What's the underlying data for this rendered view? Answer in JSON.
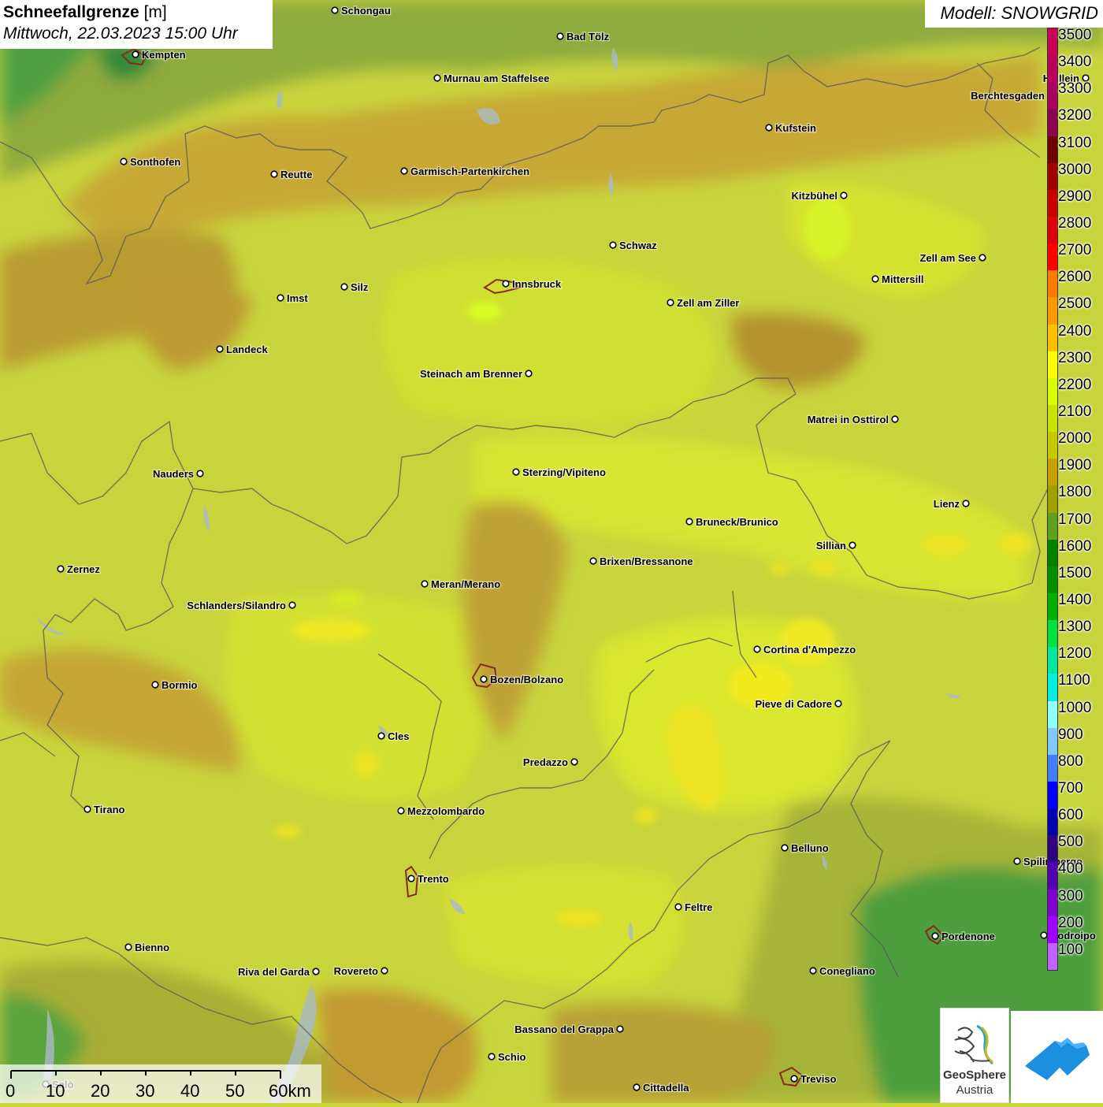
{
  "title": {
    "param": "Schneefallgrenze",
    "unit": "[m]",
    "datetime": "Mittwoch, 22.03.2023 15:00 Uhr"
  },
  "model": "Modell: SNOWGRID",
  "legend": {
    "labels": [
      "3500",
      "3400",
      "3300",
      "3200",
      "3100",
      "3000",
      "2900",
      "2800",
      "2700",
      "2600",
      "2500",
      "2400",
      "2300",
      "2200",
      "2100",
      "2000",
      "1900",
      "1800",
      "1700",
      "1600",
      "1500",
      "1400",
      "1300",
      "1200",
      "1100",
      "1000",
      "900",
      "800",
      "700",
      "600",
      "500",
      "400",
      "300",
      "200",
      "100"
    ],
    "colors": [
      "#c8005a",
      "#b8005c",
      "#a80060",
      "#8e0050",
      "#6e0000",
      "#a00000",
      "#c80000",
      "#e00010",
      "#ff0000",
      "#ff7a00",
      "#ff9900",
      "#ffc000",
      "#ffff00",
      "#d8ff00",
      "#c8e400",
      "#c8c800",
      "#c8a000",
      "#a0a000",
      "#60a020",
      "#008000",
      "#009000",
      "#00b000",
      "#00e040",
      "#00e8a0",
      "#00f0e0",
      "#90ffff",
      "#80c8ff",
      "#4080ff",
      "#0000ff",
      "#0000b0",
      "#300080",
      "#5000b0",
      "#8000d0",
      "#a000ff",
      "#c060ff"
    ]
  },
  "cities": [
    "Schongau",
    "Kempten",
    "Bad Tölz",
    "Murnau am Staffelsee",
    "Halllein",
    "Berchtesgaden",
    "Kufstein",
    "Sonthofen",
    "Reutte",
    "Garmisch-Partenkirchen",
    "Kitzbühel",
    "Schwaz",
    "Zell am See",
    "Innsbruck",
    "Mittersill",
    "Imst",
    "Silz",
    "Zell am Ziller",
    "Landeck",
    "Steinach am Brenner",
    "Matrei in Osttirol",
    "Nauders",
    "Sterzing/Vipiteno",
    "Lienz",
    "Bruneck/Brunico",
    "Sillian",
    "Zernez",
    "Brixen/Bressanone",
    "Meran/Merano",
    "Schlanders/Silandro",
    "Cortina d'Ampezzo",
    "Bozen/Bolzano",
    "Bormio",
    "Pieve di Cadore",
    "Cles",
    "Predazzo",
    "Tirano",
    "Mezzolombardo",
    "Belluno",
    "Spilimbergo",
    "Trento",
    "Feltre",
    "Pordenone",
    "Codroipo",
    "Bienno",
    "Riva del Garda",
    "Rovereto",
    "Conegliano",
    "Bassano del Grappa",
    "Schio",
    "Treviso",
    "Cittadella",
    "Salò"
  ],
  "scale": {
    "ticks": [
      "0",
      "10",
      "20",
      "30",
      "40",
      "50",
      "60km"
    ]
  },
  "logos": {
    "geosphere_line1": "GeoSphere",
    "geosphere_line2": "Austria"
  }
}
